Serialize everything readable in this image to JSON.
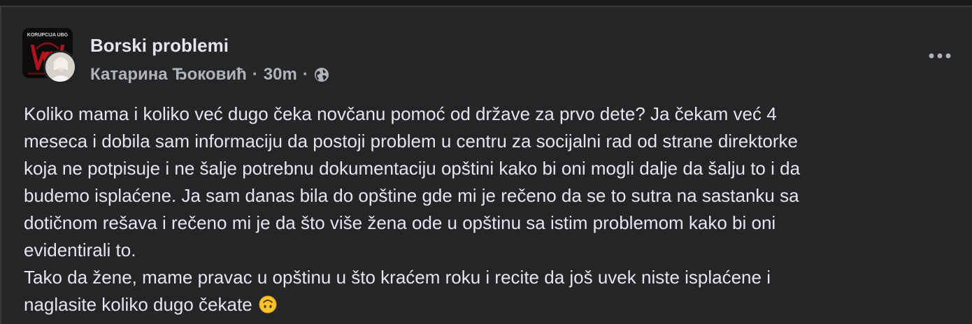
{
  "post": {
    "group_name": "Borski problemi",
    "author": "Катарина Ђоковић",
    "separator": "·",
    "time": "30m",
    "privacy_icon": "globe-icon",
    "more_icon": "more-options-icon",
    "group_avatar_text": "KORUPCIJA UBG",
    "body": "Koliko mama i koliko već dugo čeka novčanu pomoć od države za prvo dete? Ja čekam već 4\nmeseca i dobila sam informaciju da postoji problem u centru za socijalni rad od strane direktorke\nkoja ne potpisuje i ne šalje potrebnu dokumentaciju opštini kako bi oni mogli dalje da šalju to i da\nbudemo isplaćene. Ja sam danas bila do opštine gde mi je rečeno da se to sutra na sastanku sa\ndotičnom rešava i rečeno mi je da što više žena ode u opštinu sa istim problemom kako bi oni\nevidentirali to.\nTako da žene, mame pravac u opštinu u što kraćem roku i recite da još uvek niste isplaćene i\nnaglasite koliko dugo čekate",
    "emoji": "upside-down-face-emoji"
  },
  "colors": {
    "background": "#18191a",
    "card": "#242526",
    "primary_text": "#e4e6eb",
    "secondary_text": "#b0b3b8"
  }
}
